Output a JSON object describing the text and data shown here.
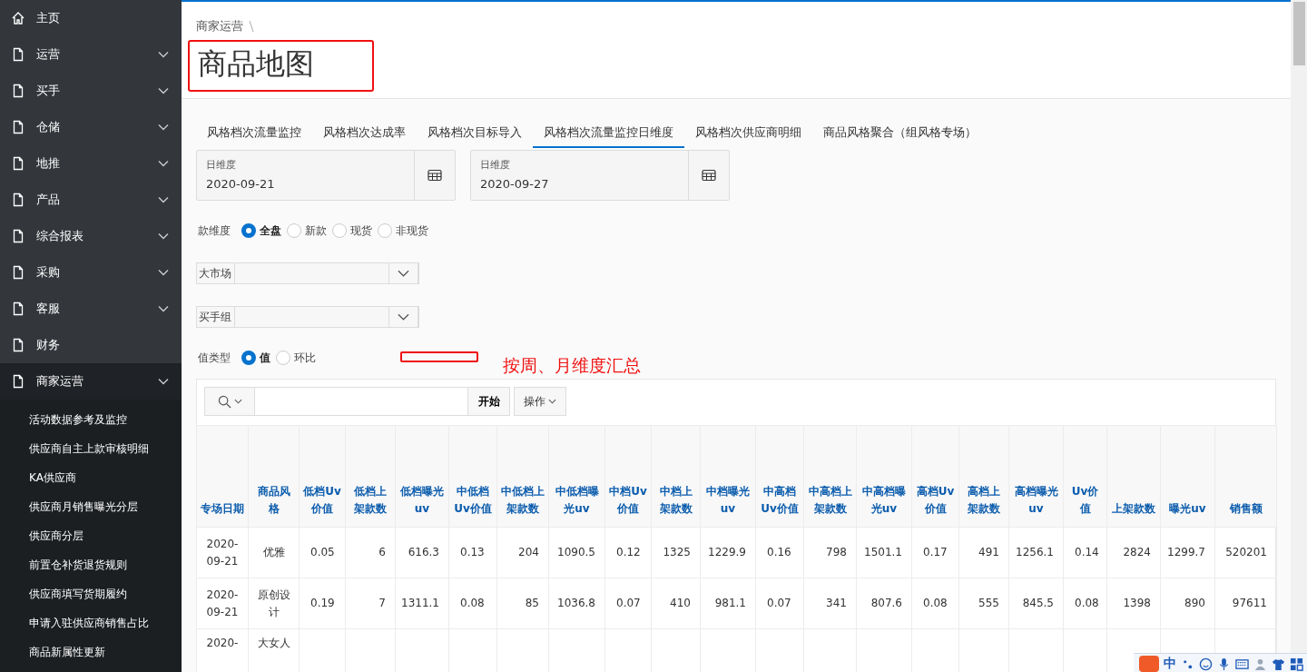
{
  "sidebar": {
    "items": [
      {
        "label": "主页",
        "kind": "home",
        "expanded": false
      },
      {
        "label": "运营",
        "kind": "page",
        "expanded": false
      },
      {
        "label": "买手",
        "kind": "page",
        "expanded": false
      },
      {
        "label": "仓储",
        "kind": "page",
        "expanded": false
      },
      {
        "label": "地推",
        "kind": "page",
        "expanded": false
      },
      {
        "label": "产品",
        "kind": "page",
        "expanded": false
      },
      {
        "label": "综合报表",
        "kind": "page",
        "expanded": false
      },
      {
        "label": "采购",
        "kind": "page",
        "expanded": false
      },
      {
        "label": "客服",
        "kind": "page",
        "expanded": false
      },
      {
        "label": "财务",
        "kind": "leaf",
        "expanded": false
      },
      {
        "label": "商家运营",
        "kind": "page",
        "expanded": true,
        "children": [
          {
            "label": "活动数据参考及监控"
          },
          {
            "label": "供应商自主上款审核明细"
          },
          {
            "label": "KA供应商"
          },
          {
            "label": "供应商月销售曝光分层"
          },
          {
            "label": "供应商分层"
          },
          {
            "label": "前置仓补货退货规则"
          },
          {
            "label": "供应商填写货期履约"
          },
          {
            "label": "申请入驻供应商销售占比"
          },
          {
            "label": "商品新属性更新"
          }
        ]
      }
    ]
  },
  "breadcrumb": [
    "商家运营"
  ],
  "page_title": "商品地图",
  "tabs": [
    {
      "label": "风格档次流量监控",
      "selected": false
    },
    {
      "label": "风格档次达成率",
      "selected": false
    },
    {
      "label": "风格档次目标导入",
      "selected": false
    },
    {
      "label": "风格档次流量监控日维度",
      "selected": true
    },
    {
      "label": "风格档次供应商明细",
      "selected": false
    },
    {
      "label": "商品风格聚合（组风格专场）",
      "selected": false
    }
  ],
  "date_fields": [
    {
      "label": "日维度",
      "value": "2020-09-21"
    },
    {
      "label": "日维度",
      "value": "2020-09-27"
    }
  ],
  "filters": [
    {
      "kind": "radio",
      "label": "款维度",
      "options": [
        {
          "label": "全盘",
          "selected": true
        },
        {
          "label": "新款",
          "selected": false
        },
        {
          "label": "现货",
          "selected": false
        },
        {
          "label": "非现货",
          "selected": false
        }
      ]
    },
    {
      "kind": "select",
      "label": "大市场"
    },
    {
      "kind": "select",
      "label": "买手组"
    },
    {
      "kind": "radio",
      "label": "值类型",
      "options": [
        {
          "label": "值",
          "selected": true
        },
        {
          "label": "环比",
          "selected": false
        }
      ]
    }
  ],
  "annotation": {
    "text": "按周、月维度汇总"
  },
  "toolbar": {
    "go_button": "开始",
    "actions_button": "操作"
  },
  "table": {
    "columns": [
      {
        "label": "专场日期",
        "kind": "text"
      },
      {
        "label": "商品风格",
        "kind": "text"
      },
      {
        "label": "低档Uv价值",
        "kind": "ratio"
      },
      {
        "label": "低档上架款数",
        "kind": "number"
      },
      {
        "label": "低档曝光uv",
        "kind": "number"
      },
      {
        "label": "中低档Uv价值",
        "kind": "ratio"
      },
      {
        "label": "中低档上架款数",
        "kind": "number"
      },
      {
        "label": "中低档曝光uv",
        "kind": "number"
      },
      {
        "label": "中档Uv价值",
        "kind": "ratio"
      },
      {
        "label": "中档上架款数",
        "kind": "number"
      },
      {
        "label": "中档曝光uv",
        "kind": "number"
      },
      {
        "label": "中高档Uv价值",
        "kind": "ratio"
      },
      {
        "label": "中高档上架款数",
        "kind": "number"
      },
      {
        "label": "中高档曝光uv",
        "kind": "number"
      },
      {
        "label": "高档Uv价值",
        "kind": "ratio"
      },
      {
        "label": "高档上架款数",
        "kind": "number"
      },
      {
        "label": "高档曝光uv",
        "kind": "number"
      },
      {
        "label": "Uv价值",
        "kind": "ratio"
      },
      {
        "label": "上架款数",
        "kind": "number"
      },
      {
        "label": "曝光uv",
        "kind": "number"
      },
      {
        "label": "销售额",
        "kind": "number"
      }
    ],
    "rows": [
      [
        "2020-09-21",
        "优雅",
        "0.05",
        "6",
        "616.3",
        "0.13",
        "204",
        "1090.5",
        "0.12",
        "1325",
        "1229.9",
        "0.16",
        "798",
        "1501.1",
        "0.17",
        "491",
        "1256.1",
        "0.14",
        "2824",
        "1299.7",
        "520201"
      ],
      [
        "2020-09-21",
        "原创设计",
        "0.19",
        "7",
        "1311.1",
        "0.08",
        "85",
        "1036.8",
        "0.07",
        "410",
        "981.1",
        "0.07",
        "341",
        "807.6",
        "0.08",
        "555",
        "845.5",
        "0.08",
        "1398",
        "890",
        "97611"
      ],
      [
        "2020-",
        "大女人"
      ]
    ]
  },
  "ime_bar": {
    "label": "中"
  }
}
